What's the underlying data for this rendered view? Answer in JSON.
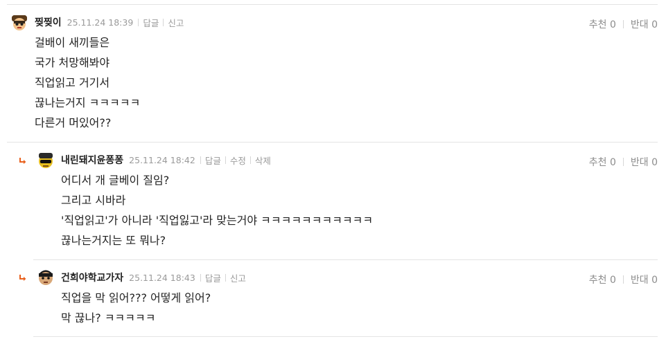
{
  "comments": [
    {
      "nickname": "찢찢이",
      "date": "25.11.24 18:39",
      "actions": [
        "답글",
        "신고"
      ],
      "vote_up_label": "추천",
      "vote_up_count": "0",
      "vote_down_label": "반대",
      "vote_down_count": "0",
      "lines": [
        "걸배이 새끼들은",
        "국가 처망해봐야",
        "직업읽고 거기서",
        "끊나는거지 ㅋㅋㅋㅋㅋ",
        "다른거 머있어??"
      ]
    },
    {
      "nickname": "내린돼지윤퐁퐁",
      "date": "25.11.24 18:42",
      "actions": [
        "답글",
        "수정",
        "삭제"
      ],
      "vote_up_label": "추천",
      "vote_up_count": "0",
      "vote_down_label": "반대",
      "vote_down_count": "0",
      "lines": [
        "어디서 개 글베이 질임?",
        "그리고 시바라",
        "'직업읽고'가 아니라 '직업잃고'라 맞는거야 ㅋㅋㅋㅋㅋㅋㅋㅋㅋㅋㅋ",
        "끊나는거지는 또 뭐나?"
      ]
    },
    {
      "nickname": "건희야학교가자",
      "date": "25.11.24 18:43",
      "actions": [
        "답글",
        "신고"
      ],
      "vote_up_label": "추천",
      "vote_up_count": "0",
      "vote_down_label": "반대",
      "vote_down_count": "0",
      "lines": [
        "직업을 막 읽어??? 어떻게 읽어?",
        "막 끊나? ㅋㅋㅋㅋㅋ"
      ]
    }
  ],
  "colors": {
    "reply_arrow": "#e8601c",
    "meta_text": "#9a9a9a",
    "divider": "#e4e4e4"
  }
}
